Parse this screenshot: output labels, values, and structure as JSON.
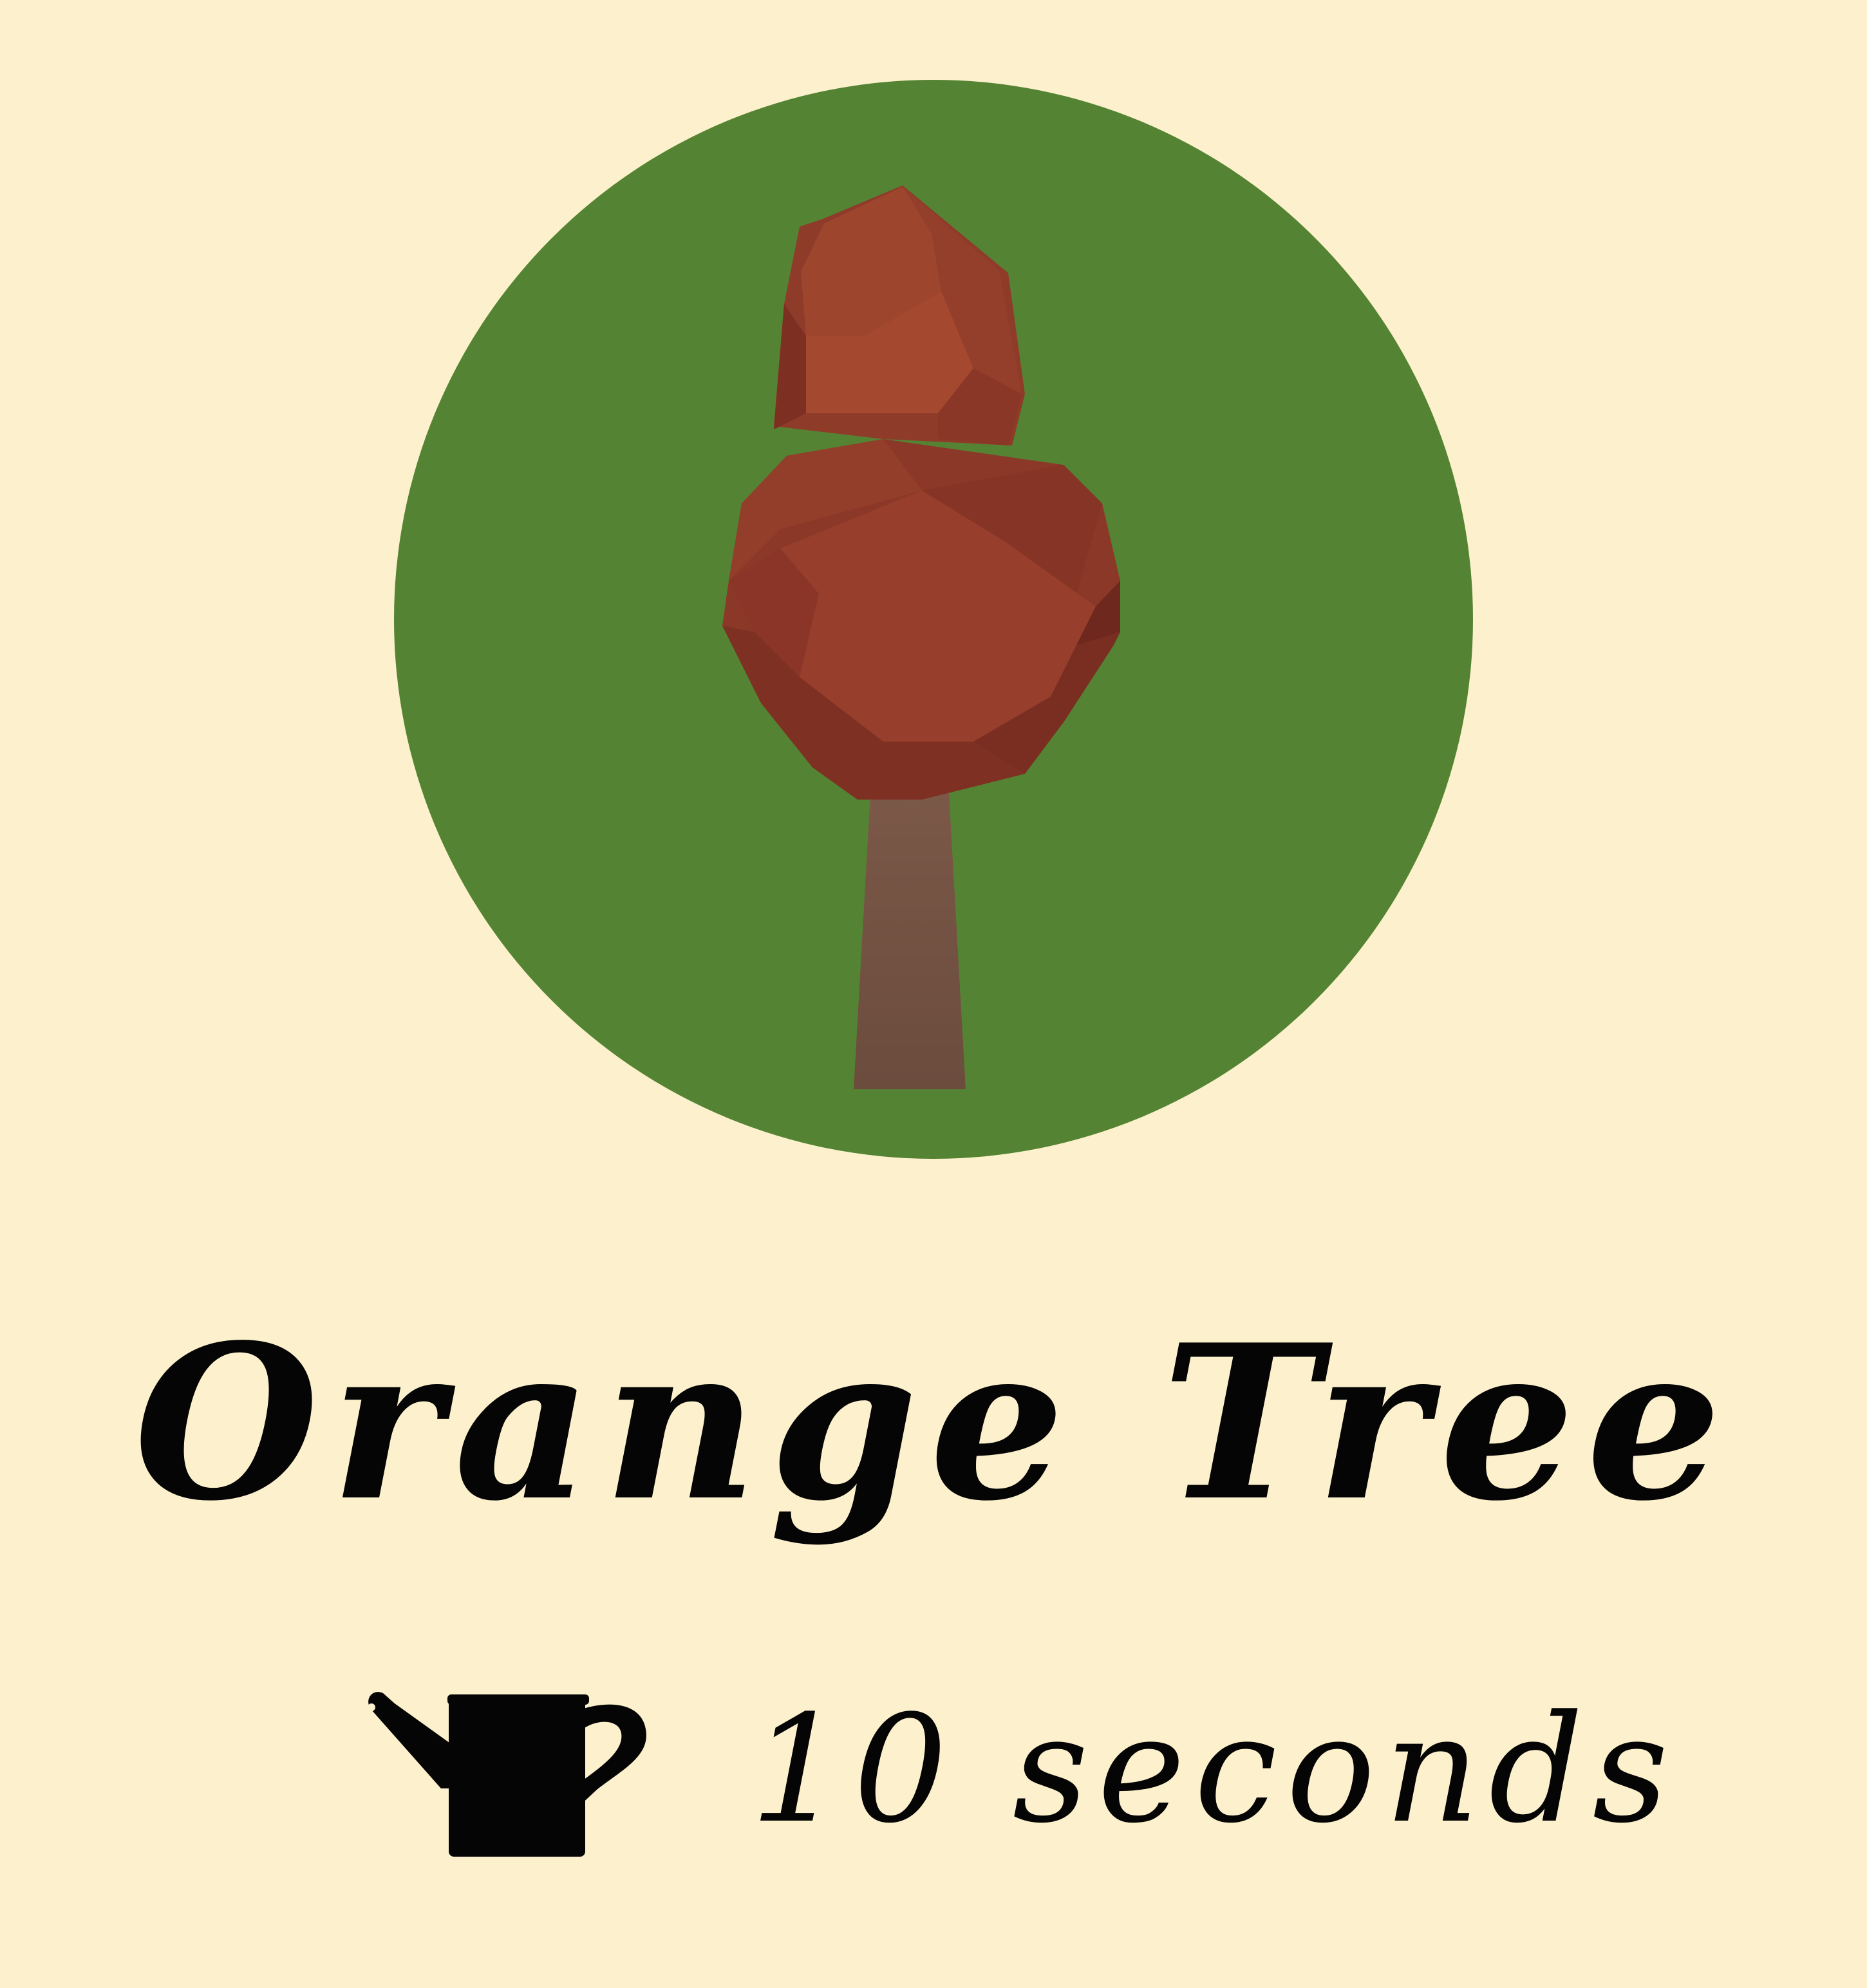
{
  "colors": {
    "background": "#fcf1cc",
    "badge": "#548433",
    "foliage": "#943f2c",
    "foliage_dark": "#7d2f22",
    "foliage_light": "#a4482f",
    "trunk": "#74503f",
    "text": "#050505"
  },
  "item": {
    "name": "Orange Tree",
    "image_icon": "orange-tree-icon"
  },
  "watering": {
    "icon": "watering-can-icon",
    "label": "10 seconds"
  }
}
